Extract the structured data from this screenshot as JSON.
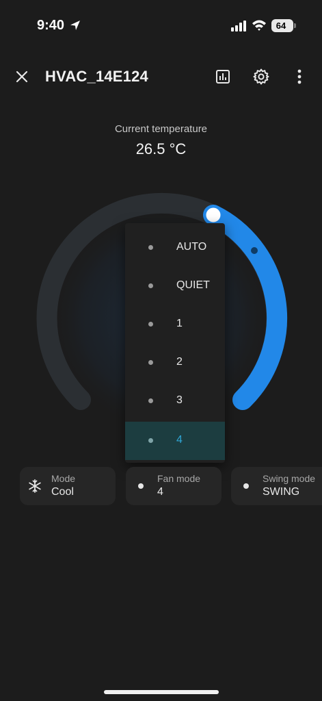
{
  "status": {
    "time": "9:40",
    "battery": "64"
  },
  "header": {
    "title": "HVAC_14E124"
  },
  "temperature": {
    "label": "Current temperature",
    "value": "26.5 °C"
  },
  "dropdown": {
    "options": [
      "AUTO",
      "QUIET",
      "1",
      "2",
      "3",
      "4"
    ],
    "selected": "4"
  },
  "chips": [
    {
      "label": "Mode",
      "value": "Cool",
      "icon": "snowflake-icon"
    },
    {
      "label": "Fan mode",
      "value": "4",
      "icon": "dot-icon"
    },
    {
      "label": "Swing mode",
      "value": "SWING",
      "icon": "dot-icon"
    }
  ],
  "colors": {
    "background": "#1c1c1c",
    "accent": "#2196f3",
    "selected_bg": "#1c3d40",
    "selected_text": "#2fa6d6"
  }
}
